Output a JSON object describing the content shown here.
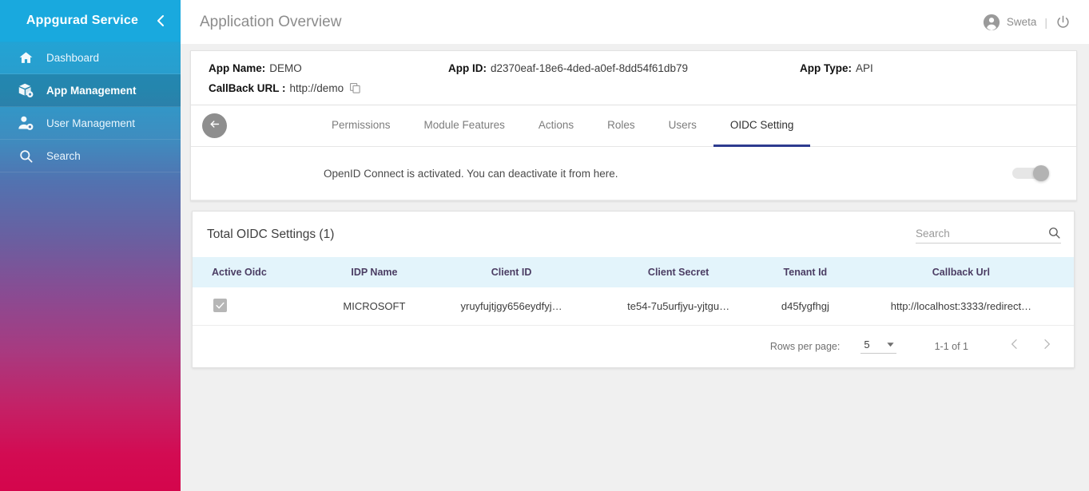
{
  "sidebar": {
    "brand": "Appgurad Service",
    "collapse_icon": "chevron-left-icon",
    "items": [
      {
        "label": "Dashboard",
        "icon": "home-icon",
        "active": false
      },
      {
        "label": "App Management",
        "icon": "box-gear-icon",
        "active": true
      },
      {
        "label": "User Management",
        "icon": "user-gear-icon",
        "active": false
      },
      {
        "label": "Search",
        "icon": "search-icon",
        "active": false
      }
    ]
  },
  "topbar": {
    "title": "Application Overview",
    "user_name": "Sweta",
    "divider": "|",
    "avatar_icon": "user-circle-icon",
    "power_icon": "power-icon"
  },
  "info": {
    "app_name_label": "App Name:",
    "app_name_value": "DEMO",
    "app_id_label": "App ID:",
    "app_id_value": "d2370eaf-18e6-4ded-a0ef-8dd54f61db79",
    "app_type_label": "App Type:",
    "app_type_value": "API",
    "callback_label": "CallBack URL :",
    "callback_value": "http://demo",
    "copy_icon": "copy-icon"
  },
  "tabs": {
    "back_icon": "arrow-left-icon",
    "items": [
      {
        "label": "Permissions",
        "active": false
      },
      {
        "label": "Module Features",
        "active": false
      },
      {
        "label": "Actions",
        "active": false
      },
      {
        "label": "Roles",
        "active": false
      },
      {
        "label": "Users",
        "active": false
      },
      {
        "label": "OIDC Setting",
        "active": true
      }
    ]
  },
  "activate": {
    "text": "OpenID Connect is activated. You can deactivate it from here.",
    "toggle_on": true
  },
  "table": {
    "title": "Total OIDC Settings (1)",
    "search_placeholder": "Search",
    "search_value": "",
    "search_icon": "search-icon",
    "columns": [
      "Active Oidc",
      "IDP Name",
      "Client ID",
      "Client Secret",
      "Tenant Id",
      "Callback Url"
    ],
    "rows": [
      {
        "active": true,
        "idp_name": "MICROSOFT",
        "client_id": "yruyfujtjgy656eydfyj…",
        "client_secret": "te54-7u5urfjyu-yjtgu…",
        "tenant_id": "d45fygfhgj",
        "callback_url": "http://localhost:3333/redirect…"
      }
    ]
  },
  "pagination": {
    "rows_per_page_label": "Rows per page:",
    "rows_per_page_value": "5",
    "range_label": "1-1 of 1",
    "prev_icon": "chevron-left-icon",
    "next_icon": "chevron-right-icon"
  },
  "colors": {
    "brand_blue": "#19a9de",
    "sidebar_end": "#d4054c",
    "tab_active_underline": "#2d3b8f",
    "table_header_bg": "#e3f4fb",
    "table_header_text": "#4b3d63"
  }
}
